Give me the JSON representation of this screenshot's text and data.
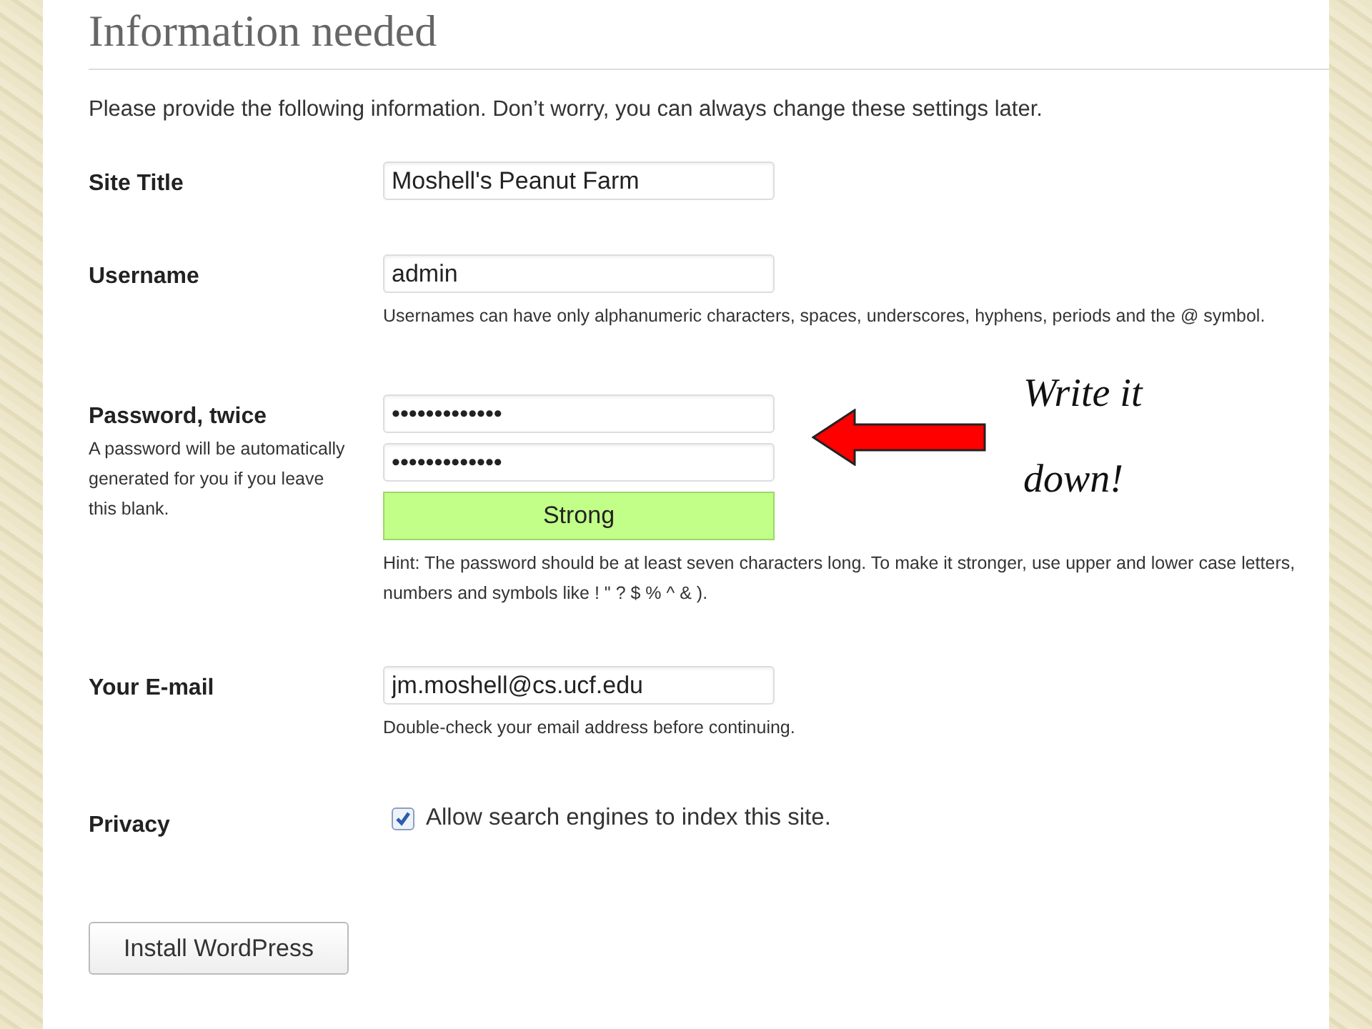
{
  "heading": "Information needed",
  "intro": "Please provide the following information. Don’t worry, you can always change these settings later.",
  "site_title": {
    "label": "Site Title",
    "value": "Moshell's Peanut Farm"
  },
  "username": {
    "label": "Username",
    "value": "admin",
    "hint": "Usernames can have only alphanumeric characters, spaces, underscores, hyphens, periods and the @ symbol."
  },
  "password": {
    "label": "Password, twice",
    "note": "A password will be automatically generated for you if you leave this blank.",
    "values": [
      "•••••••••••••",
      "•••••••••••••"
    ],
    "strength": {
      "label": "Strong",
      "kind": "strong"
    },
    "hint": "Hint: The password should be at least seven characters long. To make it stronger, use upper and lower case letters, numbers and symbols like ! \" ? $ % ^ & )."
  },
  "annotation": {
    "lines": [
      "Write it",
      "down!"
    ]
  },
  "email": {
    "label": "Your E-mail",
    "value": "jm.moshell@cs.ucf.edu",
    "hint": "Double-check your email address before continuing."
  },
  "privacy": {
    "label": "Privacy",
    "option": "Allow search engines to index this site.",
    "checked": true
  },
  "install_button": "Install WordPress"
}
